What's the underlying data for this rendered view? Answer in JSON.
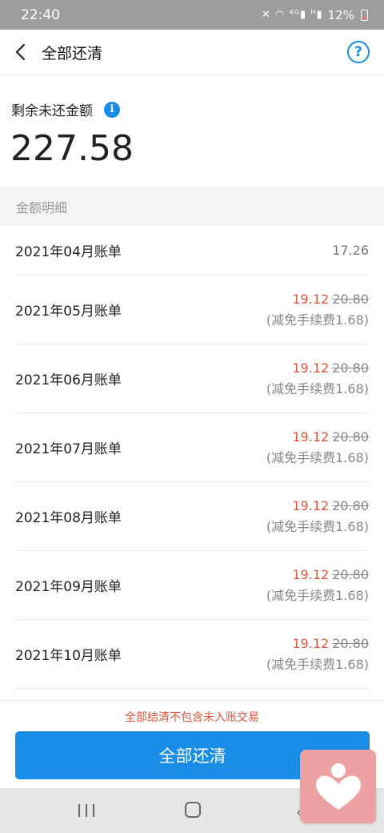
{
  "status_bar": {
    "time": "22:40",
    "icons": "✕ ◠ ⁴ᴳ▮ ᴴ▮",
    "battery": "12%"
  },
  "header": {
    "title": "全部还清",
    "help": "?"
  },
  "summary": {
    "label": "剩余未还金额",
    "info": "i",
    "amount": "227.58"
  },
  "section": {
    "title": "金额明细"
  },
  "bills": [
    {
      "label": "2021年04月账单",
      "amount": "17.26"
    },
    {
      "label": "2021年05月账单",
      "amount": "19.12",
      "original": "20.80",
      "fee_note": "(减免手续费1.68)"
    },
    {
      "label": "2021年06月账单",
      "amount": "19.12",
      "original": "20.80",
      "fee_note": "(减免手续费1.68)"
    },
    {
      "label": "2021年07月账单",
      "amount": "19.12",
      "original": "20.80",
      "fee_note": "(减免手续费1.68)"
    },
    {
      "label": "2021年08月账单",
      "amount": "19.12",
      "original": "20.80",
      "fee_note": "(减免手续费1.68)"
    },
    {
      "label": "2021年09月账单",
      "amount": "19.12",
      "original": "20.80",
      "fee_note": "(减免手续费1.68)"
    },
    {
      "label": "2021年10月账单",
      "amount": "19.12",
      "original": "20.80",
      "fee_note": "(减免手续费1.68)"
    }
  ],
  "footer": {
    "notice": "全部结清不包含未入账交易",
    "button": "全部还清"
  },
  "nav": {
    "back": "‹"
  },
  "colors": {
    "accent": "#1a8ee6",
    "discount": "#e4543a",
    "badge": "#eea1a3"
  },
  "icons": {
    "back": "chevron-left-icon",
    "help": "question-circle-icon",
    "info": "info-icon",
    "badge": "heart-person-icon"
  }
}
